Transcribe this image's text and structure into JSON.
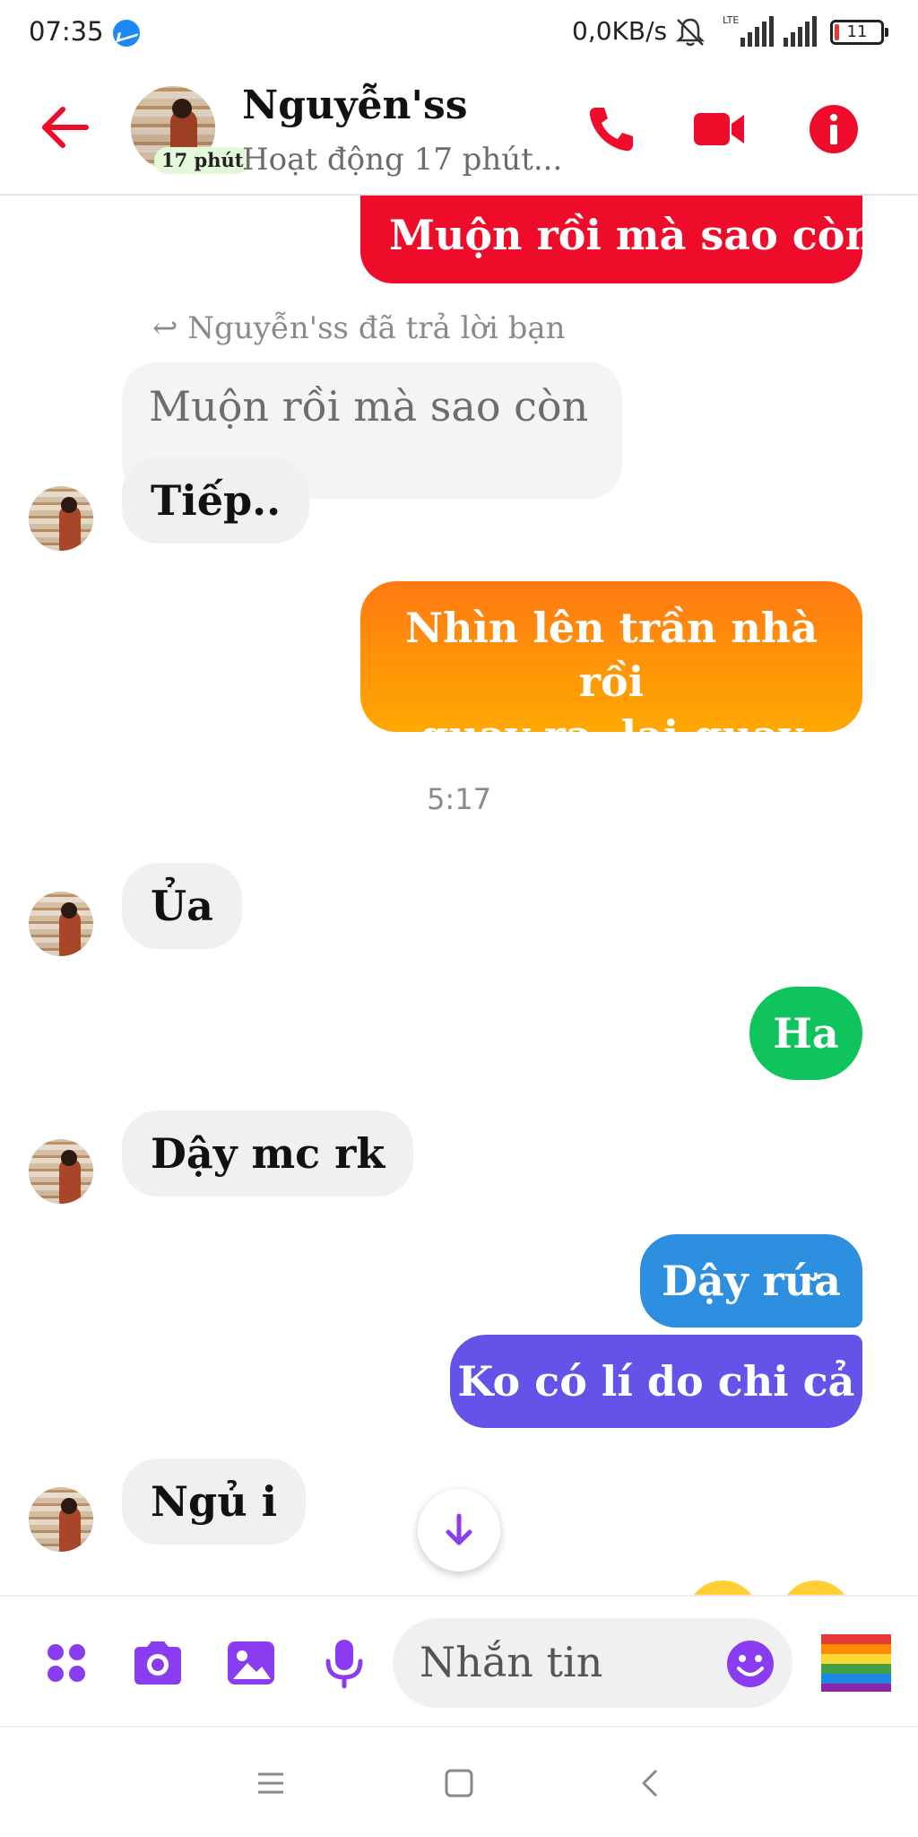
{
  "status_bar": {
    "time": "07:35",
    "network_speed": "0,0KB/s",
    "battery": "11"
  },
  "header": {
    "name": "Nguyễn'ss",
    "status": "Hoạt động 17 phút...",
    "active_badge": "17 phút",
    "accent_color": "#ee0c2a"
  },
  "messages": {
    "m1": "Muộn rồi mà sao còn",
    "reply_note": "Nguyễn'ss đã trả lời bạn",
    "quoted": "Muộn rồi mà sao còn",
    "m2": "Tiếp..",
    "m3_line1": "Nhìn lên trần nhà rồi",
    "m3_line2": "quay ra, lại quay vào",
    "time_divider": "5:17",
    "m4": "Ủa",
    "m5": "Ha",
    "m6": "Dậy mc rk",
    "m7": "Dậy rứa",
    "m8": "Ko có lí do chi cả",
    "m9": "Ngủ i"
  },
  "composer": {
    "placeholder": "Nhắn tin",
    "theme_color": "#8a3df0"
  }
}
